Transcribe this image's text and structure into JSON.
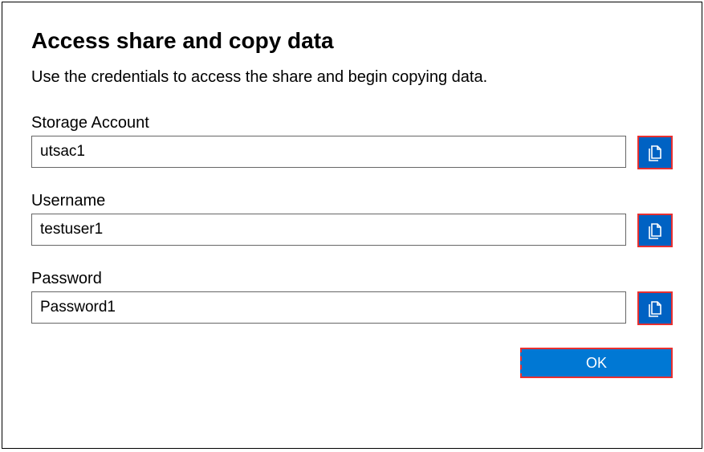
{
  "title": "Access share and copy data",
  "subtitle": "Use the credentials to access the share and begin copying data.",
  "fields": {
    "storageAccount": {
      "label": "Storage Account",
      "value": "utsac1"
    },
    "username": {
      "label": "Username",
      "value": "testuser1"
    },
    "password": {
      "label": "Password",
      "value": "Password1"
    }
  },
  "buttons": {
    "ok": "OK"
  }
}
